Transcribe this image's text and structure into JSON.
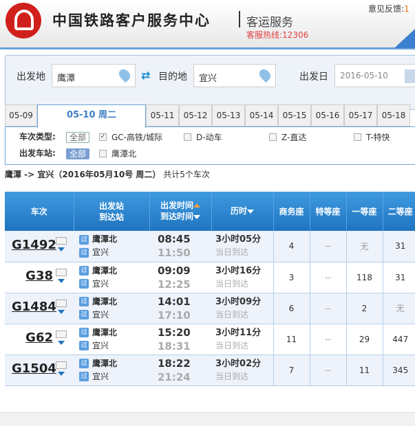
{
  "header": {
    "brand": "中国铁路客户服务中心",
    "service": "客运服务",
    "hotline": "客服热线:12306",
    "feedback_label": "意见反馈:",
    "feedback_value": "1"
  },
  "search": {
    "from_label": "出发地",
    "from_value": "鹰潭",
    "to_label": "目的地",
    "to_value": "宜兴",
    "date_label": "出发日",
    "date_value": "2016-05-10"
  },
  "date_tabs": [
    "05-09",
    "05-10 周二",
    "05-11",
    "05-12",
    "05-13",
    "05-14",
    "05-15",
    "05-16",
    "05-17",
    "05-18"
  ],
  "active_tab": 1,
  "filters": {
    "type_label": "车次类型:",
    "all": "全部",
    "types": [
      {
        "label": "GC-高铁/城际",
        "checked": true
      },
      {
        "label": "D-动车",
        "checked": false
      },
      {
        "label": "Z-直达",
        "checked": false
      },
      {
        "label": "T-特快",
        "checked": false
      }
    ],
    "station_label": "出发车站:",
    "stations": [
      {
        "label": "鹰潭北",
        "checked": false
      }
    ]
  },
  "summary": {
    "route": "鹰潭 -> 宜兴（2016年05月10号  周二）",
    "count": "共计5个车次"
  },
  "table": {
    "headers": {
      "train": "车次",
      "from": "出发站",
      "to": "到达站",
      "dep": "出发时间",
      "arr": "到达时间",
      "dur": "历时",
      "swz": "商务座",
      "tdz": "特等座",
      "ydz": "一等座",
      "edz": "二等座"
    },
    "pass_icon": "过",
    "rows": [
      {
        "train": "G1492",
        "from": "鹰潭北",
        "to": "宜兴",
        "dep": "08:45",
        "arr": "11:50",
        "dur": "3小时05分",
        "arrive_day": "当日到达",
        "swz": "4",
        "tdz": "--",
        "ydz": "无",
        "edz": "31"
      },
      {
        "train": "G38",
        "from": "鹰潭北",
        "to": "宜兴",
        "dep": "09:09",
        "arr": "12:25",
        "dur": "3小时16分",
        "arrive_day": "当日到达",
        "swz": "3",
        "tdz": "--",
        "ydz": "118",
        "edz": "31"
      },
      {
        "train": "G1484",
        "from": "鹰潭北",
        "to": "宜兴",
        "dep": "14:01",
        "arr": "17:10",
        "dur": "3小时09分",
        "arrive_day": "当日到达",
        "swz": "6",
        "tdz": "--",
        "ydz": "2",
        "edz": "无"
      },
      {
        "train": "G62",
        "from": "鹰潭北",
        "to": "宜兴",
        "dep": "15:20",
        "arr": "18:31",
        "dur": "3小时11分",
        "arrive_day": "当日到达",
        "swz": "11",
        "tdz": "--",
        "ydz": "29",
        "edz": "447"
      },
      {
        "train": "G1504",
        "from": "鹰潭北",
        "to": "宜兴",
        "dep": "18:22",
        "arr": "21:24",
        "dur": "3小时02分",
        "arrive_day": "当日到达",
        "swz": "7",
        "tdz": "--",
        "ydz": "11",
        "edz": "345"
      }
    ]
  }
}
